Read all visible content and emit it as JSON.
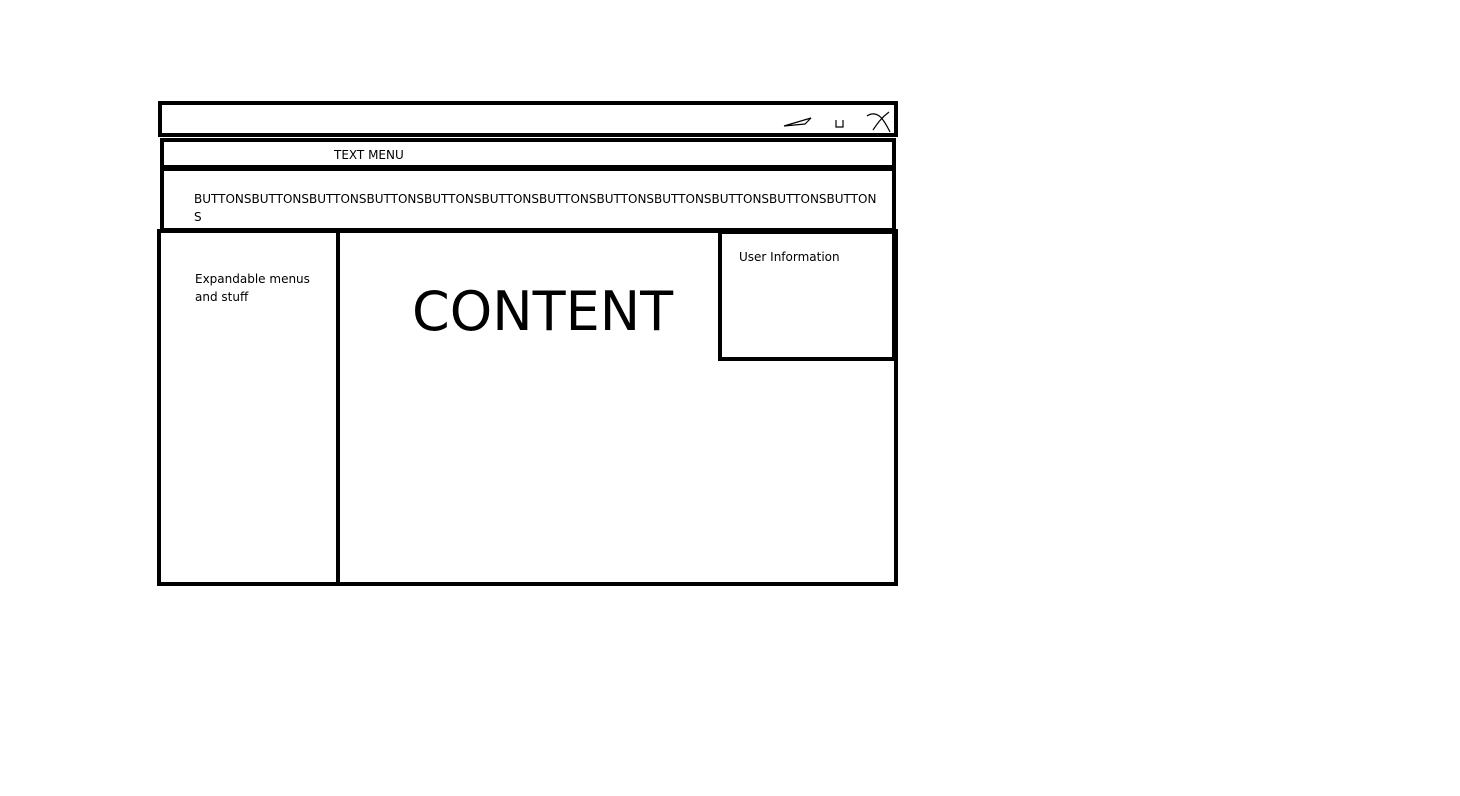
{
  "window": {
    "controls": [
      {
        "name": "minimize",
        "icon": "minimize-icon"
      },
      {
        "name": "maximize",
        "icon": "maximize-icon"
      },
      {
        "name": "close",
        "icon": "close-icon"
      }
    ]
  },
  "menu_bar": {
    "label": "TEXT MENU"
  },
  "toolbar": {
    "label": "BUTTONSBUTTONSBUTTONSBUTTONSBUTTONSBUTTONSBUTTONSBUTTONSBUTTONSBUTTONSBUTTONSBUTTONS"
  },
  "sidebar": {
    "label": "Expandable menus and stuff"
  },
  "main": {
    "title": "CONTENT"
  },
  "user_panel": {
    "label": "User Information"
  }
}
